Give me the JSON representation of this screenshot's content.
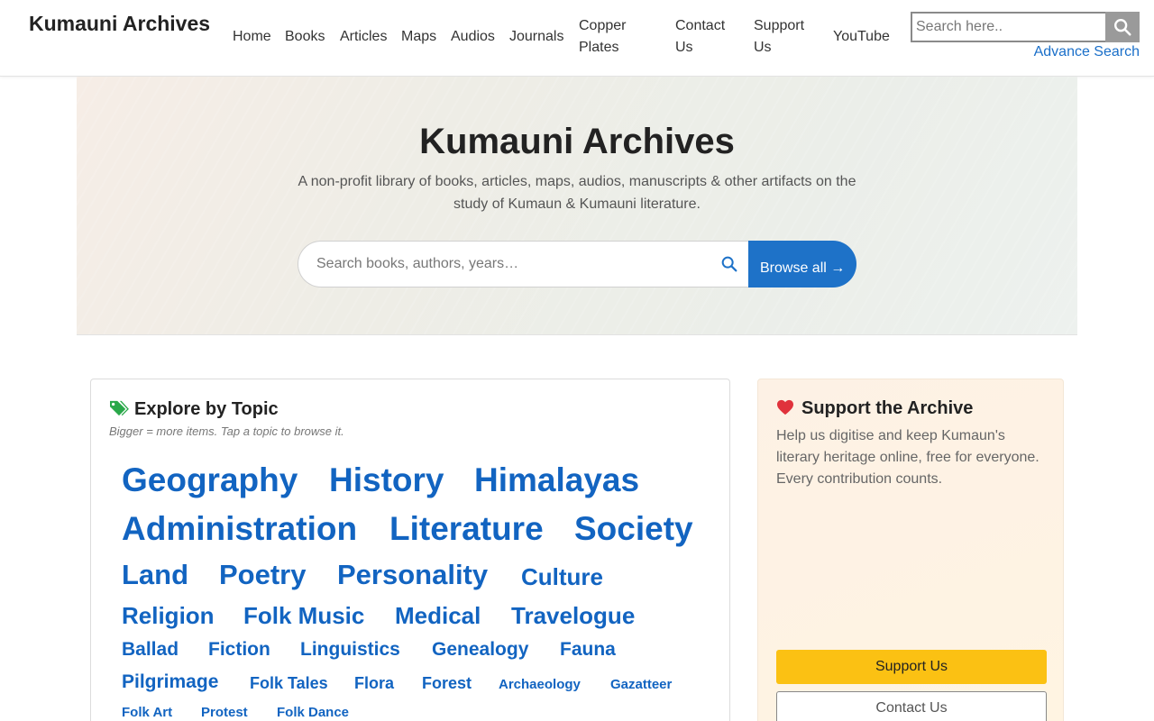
{
  "header": {
    "brand": "Kumauni Archives",
    "nav": [
      {
        "label": "Home"
      },
      {
        "label": "Books"
      },
      {
        "label": "Articles"
      },
      {
        "label": "Maps"
      },
      {
        "label": "Audios"
      },
      {
        "label": "Journals"
      },
      {
        "label": "Copper Plates"
      },
      {
        "label": "Contact Us"
      },
      {
        "label": "Support Us"
      },
      {
        "label": "YouTube"
      }
    ],
    "search_placeholder": "Search here..",
    "search_icon": "search-icon",
    "advance_search": "Advance Search"
  },
  "hero": {
    "title": "Kumauni Archives",
    "subtitle": "A non-profit library of books, articles, maps, audios, manuscripts & other artifacts on the study of Kumaun & Kumauni literature.",
    "search_placeholder": "Search books, authors, years…",
    "browse_label": "Browse all →"
  },
  "topics": {
    "title": "Explore by Topic",
    "hint": "Bigger = more items. Tap a topic to browse it.",
    "icon": "tags-icon",
    "tags": [
      {
        "label": "Geography"
      },
      {
        "label": "History"
      },
      {
        "label": "Himalayas"
      },
      {
        "label": "Administration"
      },
      {
        "label": "Literature"
      },
      {
        "label": "Society"
      },
      {
        "label": "Land"
      },
      {
        "label": "Poetry"
      },
      {
        "label": "Personality"
      },
      {
        "label": "Culture"
      },
      {
        "label": "Religion"
      },
      {
        "label": "Folk Music"
      },
      {
        "label": "Medical"
      },
      {
        "label": "Travelogue"
      },
      {
        "label": "Ballad"
      },
      {
        "label": "Fiction"
      },
      {
        "label": "Linguistics"
      },
      {
        "label": "Genealogy"
      },
      {
        "label": "Fauna"
      },
      {
        "label": "Pilgrimage"
      },
      {
        "label": "Folk Tales"
      },
      {
        "label": "Flora"
      },
      {
        "label": "Forest"
      },
      {
        "label": "Archaeology"
      },
      {
        "label": "Gazatteer"
      },
      {
        "label": "Folk Art"
      },
      {
        "label": "Protest"
      },
      {
        "label": "Folk Dance"
      }
    ]
  },
  "support": {
    "title": "Support the Archive",
    "icon": "heart-icon",
    "text": "Help us digitise and keep Kumaun's literary heritage online, free for everyone. Every contribution counts.",
    "support_button": "Support Us",
    "contact_button": "Contact Us"
  },
  "colors": {
    "link": "#1264c1",
    "browse_button": "#1e72c8",
    "support_button": "#fbc113",
    "heart": "#e0323c",
    "tags_icon": "#2aa84a"
  }
}
